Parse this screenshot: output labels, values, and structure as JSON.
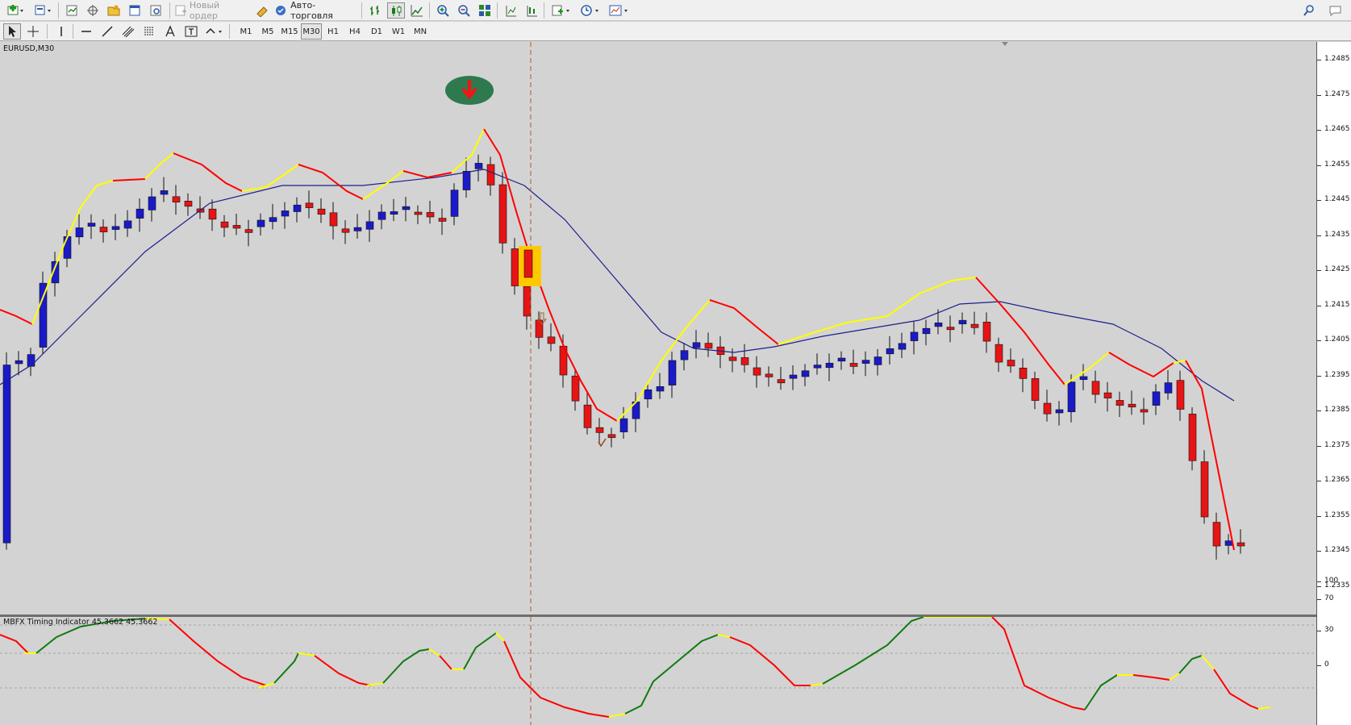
{
  "toolbar": {
    "new_order_label": "Новый ордер",
    "autotrade_label": "Авто-торговля"
  },
  "timeframes": [
    "M1",
    "M5",
    "M15",
    "M30",
    "H1",
    "H4",
    "D1",
    "W1",
    "MN"
  ],
  "active_timeframe": "M30",
  "chart": {
    "symbol_label": "EURUSD,M30",
    "price_ticks": [
      "1.2485",
      "1.2475",
      "1.2465",
      "1.2455",
      "1.2445",
      "1.2435",
      "1.2425",
      "1.2415",
      "1.2405",
      "1.2395",
      "1.2385",
      "1.2375",
      "1.2365",
      "1.2355",
      "1.2345",
      "1.2335"
    ],
    "colors": {
      "bull": "#1a1ac8",
      "bear": "#e61414",
      "ma_fast_up": "#ffff00",
      "ma_fast_down": "#ff0000",
      "ma_slow": "#1e1e8c",
      "background": "#d3d3d3"
    }
  },
  "indicator": {
    "label": "MBFX Timing Indicator 45.3662 45.3662",
    "levels": [
      "100",
      "70",
      "30",
      "0"
    ],
    "colors": {
      "up": "#117a11",
      "down": "#ff0000",
      "turn": "#ffff00"
    }
  }
}
